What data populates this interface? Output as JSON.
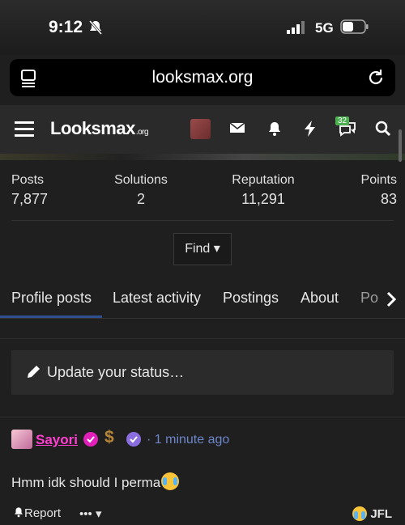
{
  "status_bar": {
    "time": "9:12",
    "network": "5G"
  },
  "browser": {
    "url": "looksmax.org"
  },
  "header": {
    "logo_main": "Looksmax",
    "logo_suffix": ".org",
    "alerts_badge": "32"
  },
  "stats": [
    {
      "label": "Posts",
      "value": "7,877"
    },
    {
      "label": "Solutions",
      "value": "2"
    },
    {
      "label": "Reputation",
      "value": "11,291"
    },
    {
      "label": "Points",
      "value": "83"
    }
  ],
  "find_button": "Find",
  "tabs": [
    {
      "label": "Profile posts",
      "active": true
    },
    {
      "label": "Latest activity"
    },
    {
      "label": "Postings"
    },
    {
      "label": "About"
    },
    {
      "label": "Po"
    }
  ],
  "status_prompt": "Update your status…",
  "post": {
    "username": "Sayori",
    "icon_1": "$",
    "separator": "·",
    "time": "1 minute ago",
    "body": "Hmm idk should I perma",
    "actions": {
      "report": "Report",
      "more": "•••"
    },
    "reaction_user": "JFL"
  },
  "colors": {
    "accent": "#2f4f8f",
    "username": "#ff3fd0",
    "link": "#6c86c9"
  }
}
